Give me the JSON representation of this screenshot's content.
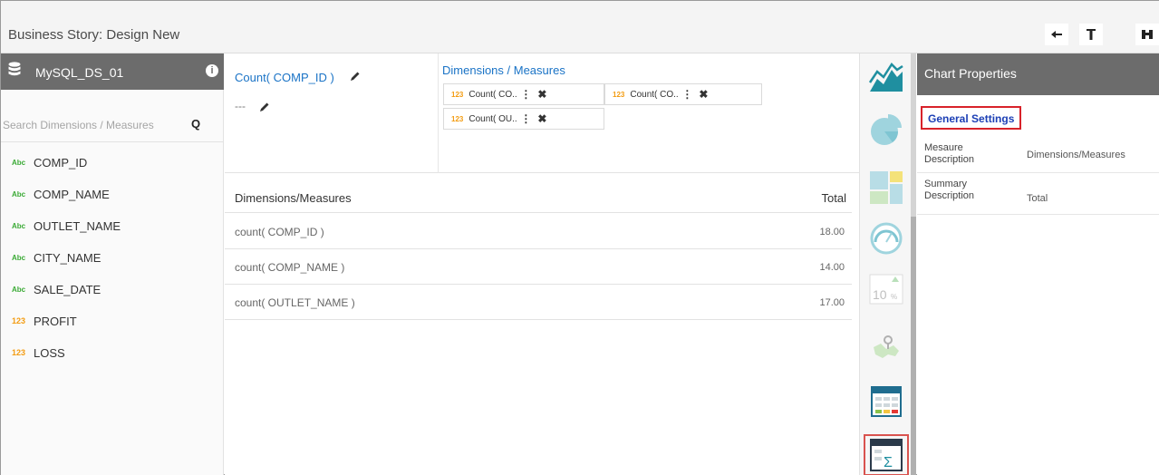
{
  "app": {
    "title": "Business Story: Design New"
  },
  "toolbar": {
    "back_icon": "arrow-left-icon",
    "filter_icon": "filter-icon",
    "save_icon": "binoculars-icon",
    "back_glyph": "🡐",
    "filter_glyph": "▼",
    "save_glyph": "⛨"
  },
  "datasource": {
    "name": "MySQL_DS_01",
    "info": "i",
    "search_placeholder": "Search Dimensions / Measures",
    "search_icon": "Q",
    "fields": [
      {
        "type": "Abc",
        "name": "COMP_ID"
      },
      {
        "type": "Abc",
        "name": "COMP_NAME"
      },
      {
        "type": "Abc",
        "name": "OUTLET_NAME"
      },
      {
        "type": "Abc",
        "name": "CITY_NAME"
      },
      {
        "type": "Abc",
        "name": "SALE_DATE"
      },
      {
        "type": "123",
        "name": "PROFIT"
      },
      {
        "type": "123",
        "name": "LOSS"
      }
    ]
  },
  "config": {
    "measure_label": "Count( COMP_ID )",
    "empty_slot": "---",
    "dm_title": "Dimensions / Measures",
    "chips": [
      {
        "type": "123",
        "label": "Count( CO..",
        "dots": "⋮",
        "x": "✖"
      },
      {
        "type": "123",
        "label": "Count( CO..",
        "dots": "⋮",
        "x": "✖"
      },
      {
        "type": "123",
        "label": "Count( OU..",
        "dots": "⋮",
        "x": "✖"
      }
    ]
  },
  "table": {
    "headers": [
      "Dimensions/Measures",
      "Total"
    ],
    "rows": [
      {
        "label": "count( COMP_ID )",
        "total": "18.00"
      },
      {
        "label": "count( COMP_NAME )",
        "total": "14.00"
      },
      {
        "label": "count( OUTLET_NAME )",
        "total": "17.00"
      }
    ]
  },
  "chart_types": [
    "area-chart-icon",
    "pie-chart-icon",
    "treemap-icon",
    "gauge-icon",
    "kpi-icon",
    "map-icon",
    "table-icon",
    "summary-table-icon"
  ],
  "colors": {
    "accent_blue": "#1a73c6",
    "selected_red": "#d8222a",
    "header_grey": "#6c6c6c",
    "chart_teal": "#1f8fa0"
  },
  "properties": {
    "title": "Chart Properties",
    "section": "General Settings",
    "items": [
      {
        "key": "Mesaure Description",
        "value": "Dimensions/Measures"
      },
      {
        "key": "Summary Description",
        "value": "Total"
      }
    ]
  }
}
